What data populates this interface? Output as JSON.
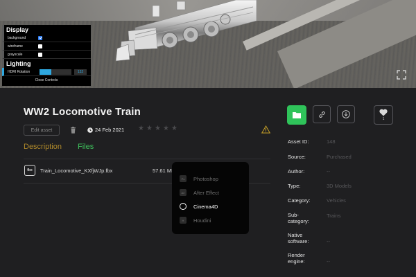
{
  "viewer": {
    "controls": {
      "display_heading": "Display",
      "options": [
        {
          "label": "background",
          "checked": true
        },
        {
          "label": "wireframe",
          "checked": false
        },
        {
          "label": "grayscale",
          "checked": false
        }
      ],
      "lighting_heading": "Lighting",
      "hdri_label": "HDRI Rotation",
      "hdri_value": "132",
      "hdri_fraction": 0.37,
      "close_label": "Close Controls"
    }
  },
  "asset": {
    "title": "WW2 Locomotive Train",
    "edit_label": "Edit asset",
    "date": "24 Feb 2021",
    "rating": 0,
    "tabs": {
      "description": "Description",
      "files": "Files"
    },
    "file": {
      "icon_text": "fbx",
      "name": "Train_Locomotive_KXfjWJp.fbx",
      "size": "57.61 MB"
    }
  },
  "app_menu": [
    {
      "label": "Photoshop",
      "icon": "Ps",
      "active": false
    },
    {
      "label": "After Effect",
      "icon": "Ae",
      "active": false
    },
    {
      "label": "Cinema4D",
      "icon": "C4D",
      "active": true
    },
    {
      "label": "Houdini",
      "icon": "H",
      "active": false
    }
  ],
  "actions": {
    "like_count": "1"
  },
  "meta": [
    {
      "label": "Asset ID:",
      "value": "148"
    },
    {
      "label": "Source:",
      "value": "Purchased"
    },
    {
      "label": "Author:",
      "value": "--"
    },
    {
      "label": "Type:",
      "value": "3D Models"
    },
    {
      "label": "Category:",
      "value": "Vehicles"
    },
    {
      "label": "Sub-",
      "label2": "category:",
      "value": "Trains"
    },
    {
      "label": "Native",
      "label2": "software:",
      "value": "--"
    },
    {
      "label": "Render",
      "label2": "engine:",
      "value": "--"
    }
  ],
  "colors": {
    "accent_green": "#2fc35a",
    "tab_inactive": "#b08a2a",
    "warning": "#c9a227"
  }
}
